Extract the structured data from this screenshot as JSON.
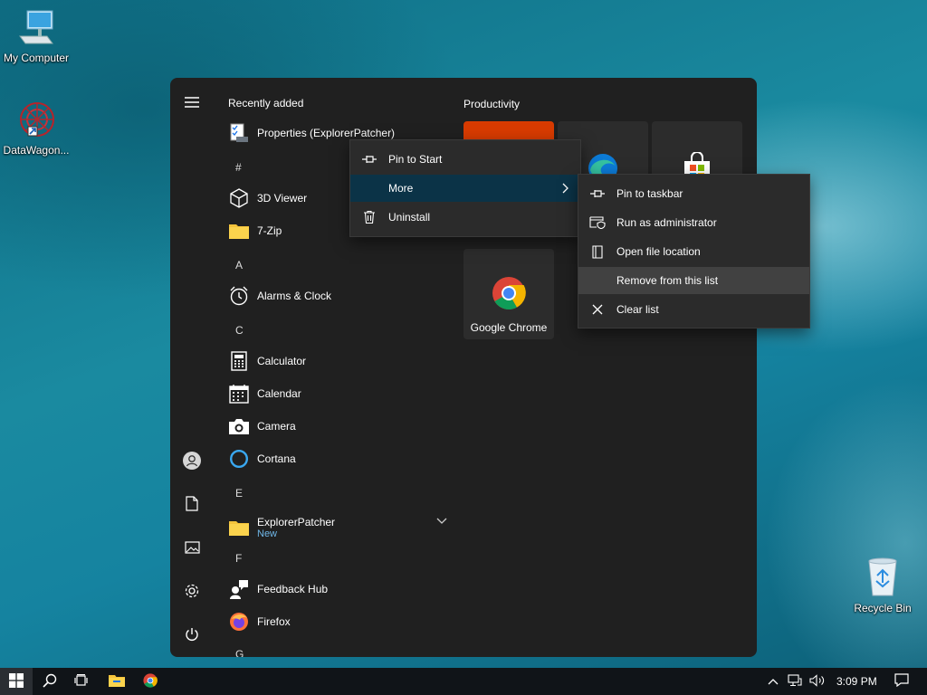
{
  "desktop": {
    "icons": [
      {
        "label": "My Computer",
        "icon": "computer-icon"
      },
      {
        "label": "DataWagon...",
        "icon": "shortcut-app-icon"
      },
      {
        "label": "Recycle Bin",
        "icon": "recycle-bin-icon"
      }
    ]
  },
  "start_menu": {
    "recent_title": "Recently added",
    "recent_item": "Properties (ExplorerPatcher)",
    "groups": [
      {
        "letter": "#",
        "apps": [
          "3D Viewer",
          "7-Zip"
        ]
      },
      {
        "letter": "A",
        "apps": [
          "Alarms & Clock"
        ]
      },
      {
        "letter": "C",
        "apps": [
          "Calculator",
          "Calendar",
          "Camera",
          "Cortana"
        ]
      },
      {
        "letter": "E",
        "apps": [
          "ExplorerPatcher"
        ]
      },
      {
        "letter": "F",
        "apps": [
          "Feedback Hub",
          "Firefox"
        ]
      },
      {
        "letter": "G",
        "apps": []
      }
    ],
    "explorerpatcher_badge": "New",
    "tiles_group_title": "Productivity",
    "chrome_tile_label": "Google Chrome"
  },
  "context_menu": {
    "items": [
      "Pin to Start",
      "More",
      "Uninstall"
    ]
  },
  "submenu": {
    "items": [
      "Pin to taskbar",
      "Run as administrator",
      "Open file location",
      "Remove from this list",
      "Clear list"
    ]
  },
  "taskbar": {
    "time": "3:09 PM"
  },
  "colors": {
    "accent_highlight": "#0b3347",
    "menu_bg": "#2b2b2b",
    "start_bg": "#202020",
    "new_badge": "#6fb7e8"
  }
}
